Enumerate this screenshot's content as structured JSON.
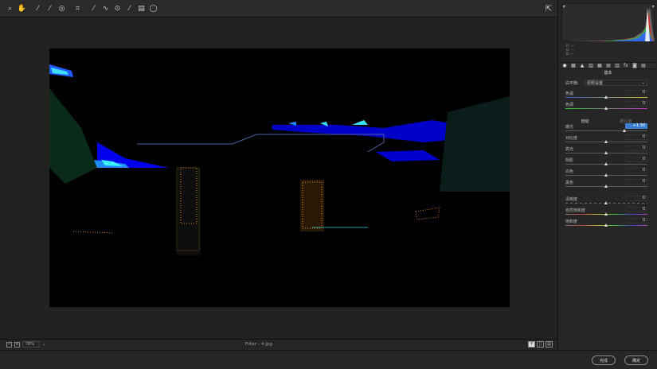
{
  "toolbar": {
    "tools": [
      {
        "name": "zoom-tool-icon",
        "glyph": "⌕"
      },
      {
        "name": "hand-tool-icon",
        "glyph": "✋"
      },
      {
        "name": "white-balance-tool-icon",
        "glyph": "⁄"
      },
      {
        "name": "color-sampler-tool-icon",
        "glyph": "⁄"
      },
      {
        "name": "targeted-adjustment-tool-icon",
        "glyph": "◎"
      },
      {
        "name": "crop-tool-icon",
        "glyph": "⌗"
      },
      {
        "name": "straighten-tool-icon",
        "glyph": "⁄"
      },
      {
        "name": "spot-removal-tool-icon",
        "glyph": "∿"
      },
      {
        "name": "red-eye-tool-icon",
        "glyph": "⊙"
      },
      {
        "name": "adjustment-brush-icon",
        "glyph": "⁄"
      },
      {
        "name": "graduated-filter-icon",
        "glyph": "▤"
      },
      {
        "name": "radial-filter-icon",
        "glyph": "◯"
      }
    ],
    "fullscreen_glyph": "⇱"
  },
  "histogram": {
    "r": "R:",
    "g": "G:",
    "b": "B:",
    "r_val": "---",
    "g_val": "---",
    "b_val": "---"
  },
  "panel": {
    "section_title": "基本",
    "tabs": [
      "◉",
      "▦",
      "▲",
      "▥",
      "▦",
      "▤",
      "▥",
      "fx",
      "◙",
      "▤"
    ],
    "white_balance_label": "白平衡:",
    "white_balance_value": "原照设置",
    "temperature": {
      "label": "色温",
      "value": "0"
    },
    "tint": {
      "label": "色调",
      "value": "0"
    },
    "subtab_auto": "自动",
    "subtab_default": "默认值",
    "exposure": {
      "label": "曝光",
      "value": "+1.30"
    },
    "contrast": {
      "label": "对比度",
      "value": "0"
    },
    "highlights": {
      "label": "高光",
      "value": "0"
    },
    "shadows": {
      "label": "阴影",
      "value": "0"
    },
    "whites": {
      "label": "白色",
      "value": "0"
    },
    "blacks": {
      "label": "黑色",
      "value": "0"
    },
    "clarity": {
      "label": "清晰度",
      "value": "0"
    },
    "vibrance": {
      "label": "自然饱和度",
      "value": "0"
    },
    "saturation": {
      "label": "饱和度",
      "value": "0"
    }
  },
  "status": {
    "zoom_value": "78%",
    "filename": "Filter - 4.jpg",
    "view_buttons": [
      "Y",
      "▯",
      "▤"
    ]
  },
  "buttons": {
    "open": "完成",
    "ok": "确定"
  },
  "colors": {
    "accent": "#3d80d0",
    "background": "#1f1f1f",
    "panel": "#262626"
  }
}
